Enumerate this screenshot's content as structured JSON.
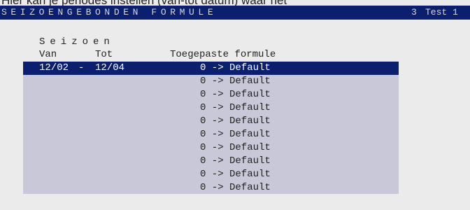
{
  "clipped_caption": "Hier kan je periodes instellen (van-tot datum) waar het",
  "title_bar": {
    "title": "SEIZOENGEBONDEN FORMULE",
    "number": "3",
    "user": "Test 1"
  },
  "section_heading": "Seizoen",
  "columns": {
    "from": "Van",
    "to": "Tot",
    "formula": "Toegepaste formule"
  },
  "rows": [
    {
      "from": "12/02",
      "sep": "-",
      "to": "12/04",
      "formula": "0 -> Default",
      "selected": true
    },
    {
      "from": "",
      "sep": "",
      "to": "",
      "formula": "0 -> Default",
      "selected": false
    },
    {
      "from": "",
      "sep": "",
      "to": "",
      "formula": "0 -> Default",
      "selected": false
    },
    {
      "from": "",
      "sep": "",
      "to": "",
      "formula": "0 -> Default",
      "selected": false
    },
    {
      "from": "",
      "sep": "",
      "to": "",
      "formula": "0 -> Default",
      "selected": false
    },
    {
      "from": "",
      "sep": "",
      "to": "",
      "formula": "0 -> Default",
      "selected": false
    },
    {
      "from": "",
      "sep": "",
      "to": "",
      "formula": "0 -> Default",
      "selected": false
    },
    {
      "from": "",
      "sep": "",
      "to": "",
      "formula": "0 -> Default",
      "selected": false
    },
    {
      "from": "",
      "sep": "",
      "to": "",
      "formula": "0 -> Default",
      "selected": false
    },
    {
      "from": "",
      "sep": "",
      "to": "",
      "formula": "0 -> Default",
      "selected": false
    }
  ],
  "colors": {
    "title_bar_bg": "#0c1e6e",
    "selected_row_bg": "#0c1e6e",
    "grid_bg": "#c8c8d8",
    "screen_bg": "#ebebeb"
  }
}
